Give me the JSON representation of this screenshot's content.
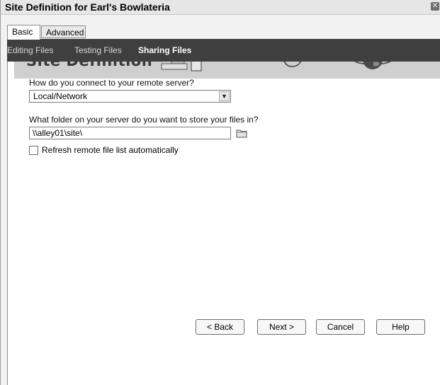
{
  "window": {
    "title": "Site Definition for Earl's Bowlateria"
  },
  "tabs": [
    {
      "label": "Basic",
      "active": true
    },
    {
      "label": "Advanced",
      "active": false
    }
  ],
  "banner": {
    "title": "Site Definition"
  },
  "steps": [
    {
      "label": "Editing Files",
      "active": false
    },
    {
      "label": "Testing Files",
      "active": false
    },
    {
      "label": "Sharing Files",
      "active": true
    }
  ],
  "form": {
    "connect_question": "How do you connect to your remote server?",
    "connect_value": "Local/Network",
    "folder_question": "What folder on your server do you want to store your files in?",
    "folder_value": "\\\\alley01\\site\\",
    "refresh_label": "Refresh remote file list automatically",
    "refresh_checked": false
  },
  "buttons": {
    "back": "< Back",
    "next": "Next >",
    "cancel": "Cancel",
    "help": "Help"
  },
  "icons": {
    "close": "close-icon",
    "folder": "folder-icon",
    "dropdown": "chevron-down-icon"
  }
}
